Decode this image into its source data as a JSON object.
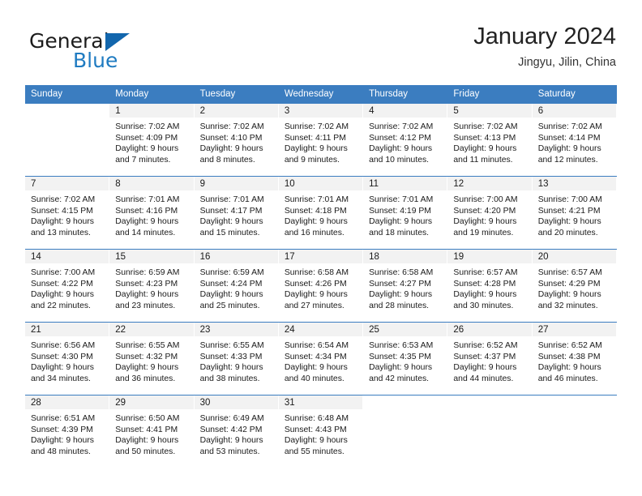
{
  "brand": {
    "name_part1": "General",
    "name_part2": "Blue",
    "accent_color": "#1266ad",
    "text_color": "#1c1c1c"
  },
  "header": {
    "title": "January 2024",
    "location": "Jingyu, Jilin, China"
  },
  "calendar": {
    "weekday_headers": [
      "Sunday",
      "Monday",
      "Tuesday",
      "Wednesday",
      "Thursday",
      "Friday",
      "Saturday"
    ],
    "header_bg": "#3b7dc0",
    "daynum_bg": "#f2f2f2",
    "weeks": [
      [
        {
          "day": "",
          "sunrise": "",
          "sunset": "",
          "daylight_line1": "",
          "daylight_line2": ""
        },
        {
          "day": "1",
          "sunrise": "Sunrise: 7:02 AM",
          "sunset": "Sunset: 4:09 PM",
          "daylight_line1": "Daylight: 9 hours",
          "daylight_line2": "and 7 minutes."
        },
        {
          "day": "2",
          "sunrise": "Sunrise: 7:02 AM",
          "sunset": "Sunset: 4:10 PM",
          "daylight_line1": "Daylight: 9 hours",
          "daylight_line2": "and 8 minutes."
        },
        {
          "day": "3",
          "sunrise": "Sunrise: 7:02 AM",
          "sunset": "Sunset: 4:11 PM",
          "daylight_line1": "Daylight: 9 hours",
          "daylight_line2": "and 9 minutes."
        },
        {
          "day": "4",
          "sunrise": "Sunrise: 7:02 AM",
          "sunset": "Sunset: 4:12 PM",
          "daylight_line1": "Daylight: 9 hours",
          "daylight_line2": "and 10 minutes."
        },
        {
          "day": "5",
          "sunrise": "Sunrise: 7:02 AM",
          "sunset": "Sunset: 4:13 PM",
          "daylight_line1": "Daylight: 9 hours",
          "daylight_line2": "and 11 minutes."
        },
        {
          "day": "6",
          "sunrise": "Sunrise: 7:02 AM",
          "sunset": "Sunset: 4:14 PM",
          "daylight_line1": "Daylight: 9 hours",
          "daylight_line2": "and 12 minutes."
        }
      ],
      [
        {
          "day": "7",
          "sunrise": "Sunrise: 7:02 AM",
          "sunset": "Sunset: 4:15 PM",
          "daylight_line1": "Daylight: 9 hours",
          "daylight_line2": "and 13 minutes."
        },
        {
          "day": "8",
          "sunrise": "Sunrise: 7:01 AM",
          "sunset": "Sunset: 4:16 PM",
          "daylight_line1": "Daylight: 9 hours",
          "daylight_line2": "and 14 minutes."
        },
        {
          "day": "9",
          "sunrise": "Sunrise: 7:01 AM",
          "sunset": "Sunset: 4:17 PM",
          "daylight_line1": "Daylight: 9 hours",
          "daylight_line2": "and 15 minutes."
        },
        {
          "day": "10",
          "sunrise": "Sunrise: 7:01 AM",
          "sunset": "Sunset: 4:18 PM",
          "daylight_line1": "Daylight: 9 hours",
          "daylight_line2": "and 16 minutes."
        },
        {
          "day": "11",
          "sunrise": "Sunrise: 7:01 AM",
          "sunset": "Sunset: 4:19 PM",
          "daylight_line1": "Daylight: 9 hours",
          "daylight_line2": "and 18 minutes."
        },
        {
          "day": "12",
          "sunrise": "Sunrise: 7:00 AM",
          "sunset": "Sunset: 4:20 PM",
          "daylight_line1": "Daylight: 9 hours",
          "daylight_line2": "and 19 minutes."
        },
        {
          "day": "13",
          "sunrise": "Sunrise: 7:00 AM",
          "sunset": "Sunset: 4:21 PM",
          "daylight_line1": "Daylight: 9 hours",
          "daylight_line2": "and 20 minutes."
        }
      ],
      [
        {
          "day": "14",
          "sunrise": "Sunrise: 7:00 AM",
          "sunset": "Sunset: 4:22 PM",
          "daylight_line1": "Daylight: 9 hours",
          "daylight_line2": "and 22 minutes."
        },
        {
          "day": "15",
          "sunrise": "Sunrise: 6:59 AM",
          "sunset": "Sunset: 4:23 PM",
          "daylight_line1": "Daylight: 9 hours",
          "daylight_line2": "and 23 minutes."
        },
        {
          "day": "16",
          "sunrise": "Sunrise: 6:59 AM",
          "sunset": "Sunset: 4:24 PM",
          "daylight_line1": "Daylight: 9 hours",
          "daylight_line2": "and 25 minutes."
        },
        {
          "day": "17",
          "sunrise": "Sunrise: 6:58 AM",
          "sunset": "Sunset: 4:26 PM",
          "daylight_line1": "Daylight: 9 hours",
          "daylight_line2": "and 27 minutes."
        },
        {
          "day": "18",
          "sunrise": "Sunrise: 6:58 AM",
          "sunset": "Sunset: 4:27 PM",
          "daylight_line1": "Daylight: 9 hours",
          "daylight_line2": "and 28 minutes."
        },
        {
          "day": "19",
          "sunrise": "Sunrise: 6:57 AM",
          "sunset": "Sunset: 4:28 PM",
          "daylight_line1": "Daylight: 9 hours",
          "daylight_line2": "and 30 minutes."
        },
        {
          "day": "20",
          "sunrise": "Sunrise: 6:57 AM",
          "sunset": "Sunset: 4:29 PM",
          "daylight_line1": "Daylight: 9 hours",
          "daylight_line2": "and 32 minutes."
        }
      ],
      [
        {
          "day": "21",
          "sunrise": "Sunrise: 6:56 AM",
          "sunset": "Sunset: 4:30 PM",
          "daylight_line1": "Daylight: 9 hours",
          "daylight_line2": "and 34 minutes."
        },
        {
          "day": "22",
          "sunrise": "Sunrise: 6:55 AM",
          "sunset": "Sunset: 4:32 PM",
          "daylight_line1": "Daylight: 9 hours",
          "daylight_line2": "and 36 minutes."
        },
        {
          "day": "23",
          "sunrise": "Sunrise: 6:55 AM",
          "sunset": "Sunset: 4:33 PM",
          "daylight_line1": "Daylight: 9 hours",
          "daylight_line2": "and 38 minutes."
        },
        {
          "day": "24",
          "sunrise": "Sunrise: 6:54 AM",
          "sunset": "Sunset: 4:34 PM",
          "daylight_line1": "Daylight: 9 hours",
          "daylight_line2": "and 40 minutes."
        },
        {
          "day": "25",
          "sunrise": "Sunrise: 6:53 AM",
          "sunset": "Sunset: 4:35 PM",
          "daylight_line1": "Daylight: 9 hours",
          "daylight_line2": "and 42 minutes."
        },
        {
          "day": "26",
          "sunrise": "Sunrise: 6:52 AM",
          "sunset": "Sunset: 4:37 PM",
          "daylight_line1": "Daylight: 9 hours",
          "daylight_line2": "and 44 minutes."
        },
        {
          "day": "27",
          "sunrise": "Sunrise: 6:52 AM",
          "sunset": "Sunset: 4:38 PM",
          "daylight_line1": "Daylight: 9 hours",
          "daylight_line2": "and 46 minutes."
        }
      ],
      [
        {
          "day": "28",
          "sunrise": "Sunrise: 6:51 AM",
          "sunset": "Sunset: 4:39 PM",
          "daylight_line1": "Daylight: 9 hours",
          "daylight_line2": "and 48 minutes."
        },
        {
          "day": "29",
          "sunrise": "Sunrise: 6:50 AM",
          "sunset": "Sunset: 4:41 PM",
          "daylight_line1": "Daylight: 9 hours",
          "daylight_line2": "and 50 minutes."
        },
        {
          "day": "30",
          "sunrise": "Sunrise: 6:49 AM",
          "sunset": "Sunset: 4:42 PM",
          "daylight_line1": "Daylight: 9 hours",
          "daylight_line2": "and 53 minutes."
        },
        {
          "day": "31",
          "sunrise": "Sunrise: 6:48 AM",
          "sunset": "Sunset: 4:43 PM",
          "daylight_line1": "Daylight: 9 hours",
          "daylight_line2": "and 55 minutes."
        },
        {
          "day": "",
          "sunrise": "",
          "sunset": "",
          "daylight_line1": "",
          "daylight_line2": ""
        },
        {
          "day": "",
          "sunrise": "",
          "sunset": "",
          "daylight_line1": "",
          "daylight_line2": ""
        },
        {
          "day": "",
          "sunrise": "",
          "sunset": "",
          "daylight_line1": "",
          "daylight_line2": ""
        }
      ]
    ]
  }
}
